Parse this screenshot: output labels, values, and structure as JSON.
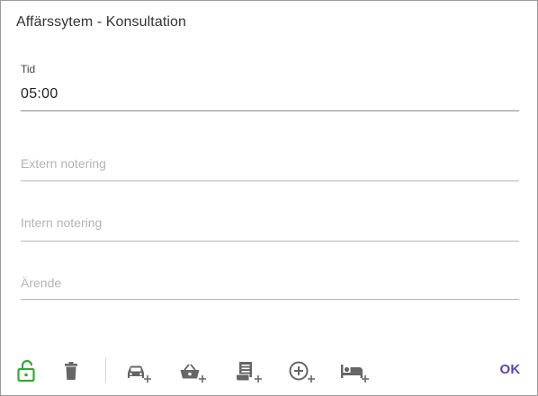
{
  "dialog": {
    "title": "Affärssytem - Konsultation"
  },
  "fields": {
    "tid": {
      "label": "Tid",
      "value": "05:00"
    },
    "extern_notering": {
      "placeholder": "Extern notering"
    },
    "intern_notering": {
      "placeholder": "Intern notering"
    },
    "arende": {
      "placeholder": "Ärende"
    }
  },
  "toolbar": {
    "icons": [
      "unlock-icon",
      "trash-icon",
      "add-car-icon",
      "add-basket-icon",
      "add-receipt-icon",
      "add-circle-icon",
      "add-bed-icon"
    ],
    "ok_label": "OK"
  },
  "colors": {
    "unlock": "#3aa53a",
    "icon_gray": "#666666",
    "accent": "#5a46a8"
  }
}
